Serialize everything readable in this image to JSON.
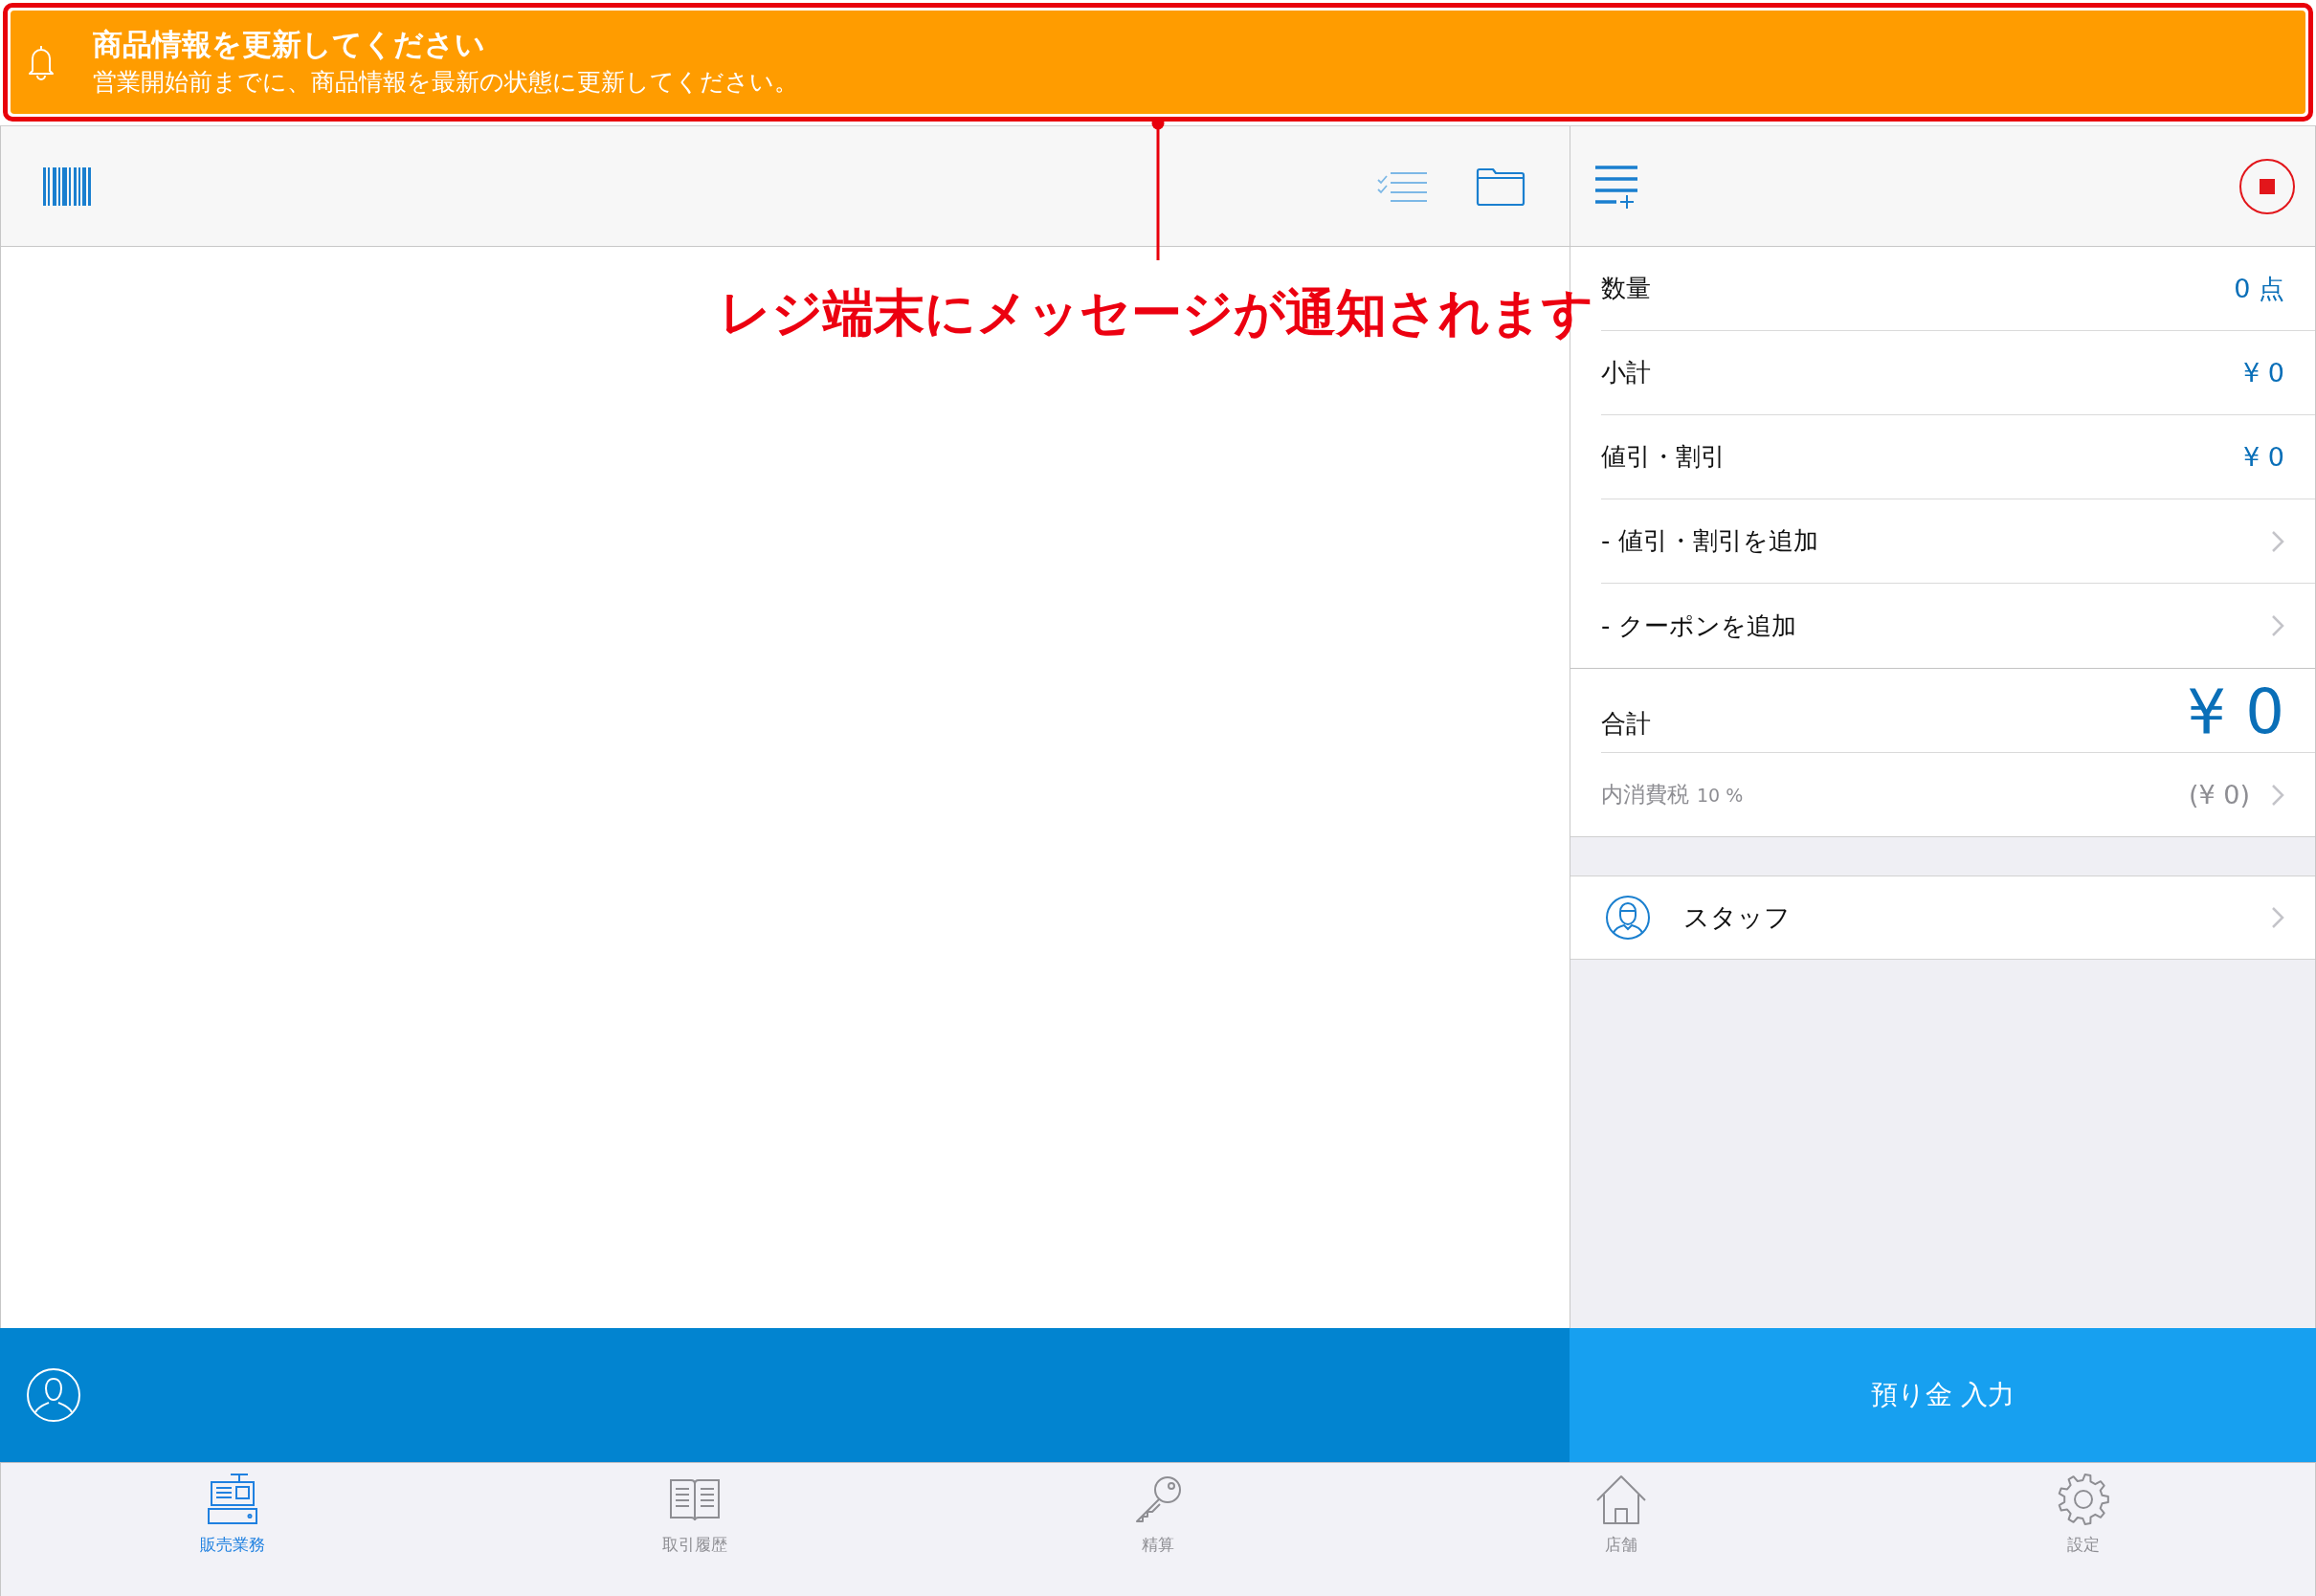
{
  "notification": {
    "title": "商品情報を更新してください",
    "message": "営業開始前までに、商品情報を最新の状態に更新してください。"
  },
  "annotation": {
    "text": "レジ端末にメッセージが通知されます"
  },
  "summary": {
    "rows": [
      {
        "kind": "value",
        "label": "数量",
        "value": "0 点"
      },
      {
        "kind": "value",
        "label": "小計",
        "value": "¥ 0"
      },
      {
        "kind": "value",
        "label": "値引・割引",
        "value": "¥ 0"
      },
      {
        "kind": "link",
        "label": "- 値引・割引を追加"
      },
      {
        "kind": "link",
        "label": "- クーポンを追加"
      }
    ],
    "total": {
      "label": "合計",
      "value": "¥ 0"
    },
    "tax": {
      "label": "内消費税",
      "rate": "10 %",
      "value": "(¥ 0)"
    }
  },
  "staff": {
    "label": "スタッフ"
  },
  "payment_button": {
    "label": "預り金 入力"
  },
  "tab_bar": {
    "tabs": [
      {
        "label": "販売業務",
        "selected": true
      },
      {
        "label": "取引履歴",
        "selected": false
      },
      {
        "label": "精算",
        "selected": false
      },
      {
        "label": "店舗",
        "selected": false
      },
      {
        "label": "設定",
        "selected": false
      }
    ]
  }
}
